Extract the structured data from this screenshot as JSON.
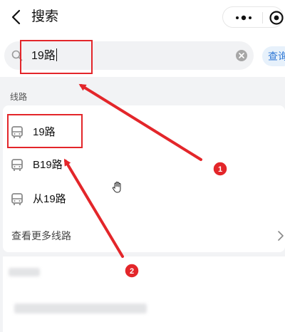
{
  "header": {
    "title": "搜索"
  },
  "search": {
    "value": "19路",
    "query_label": "查询"
  },
  "section": {
    "label": "线路"
  },
  "routes": [
    {
      "label": "19路",
      "icon": "bus-icon"
    },
    {
      "label": "B19路",
      "icon": "bus-icon"
    },
    {
      "label": "从19路",
      "icon": "bus-icon"
    }
  ],
  "more_routes_label": "查看更多线路",
  "annotations": {
    "marker_1": "1",
    "marker_2": "2"
  },
  "colors": {
    "accent": "#2f78d6",
    "highlight": "#e3262a"
  }
}
